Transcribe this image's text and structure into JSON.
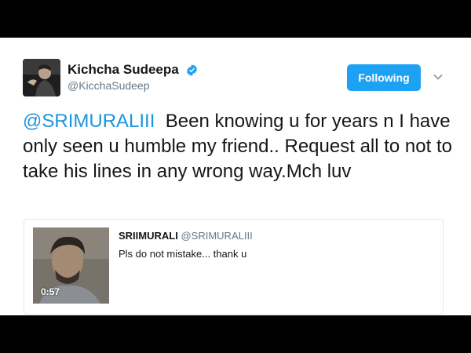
{
  "tweet": {
    "display_name": "Kichcha Sudeepa",
    "handle": "@KicchaSudeep",
    "follow_label": "Following",
    "mention": "@SRIMURALIII",
    "body": "Been knowing u for years n I have only seen u humble my friend.. Request all to not to take his lines in any wrong way.Mch luv"
  },
  "quoted": {
    "display_name": "SRIIMURALI",
    "handle": "@SRIMURALIII",
    "text": "Pls do not mistake... thank u",
    "video_duration": "0:57"
  },
  "colors": {
    "accent": "#1da1f2",
    "mention": "#1b95e0",
    "verified": "#1da1f2"
  },
  "icons": [
    "verified-badge-icon",
    "chevron-down-icon",
    "play-video-thumbnail"
  ]
}
